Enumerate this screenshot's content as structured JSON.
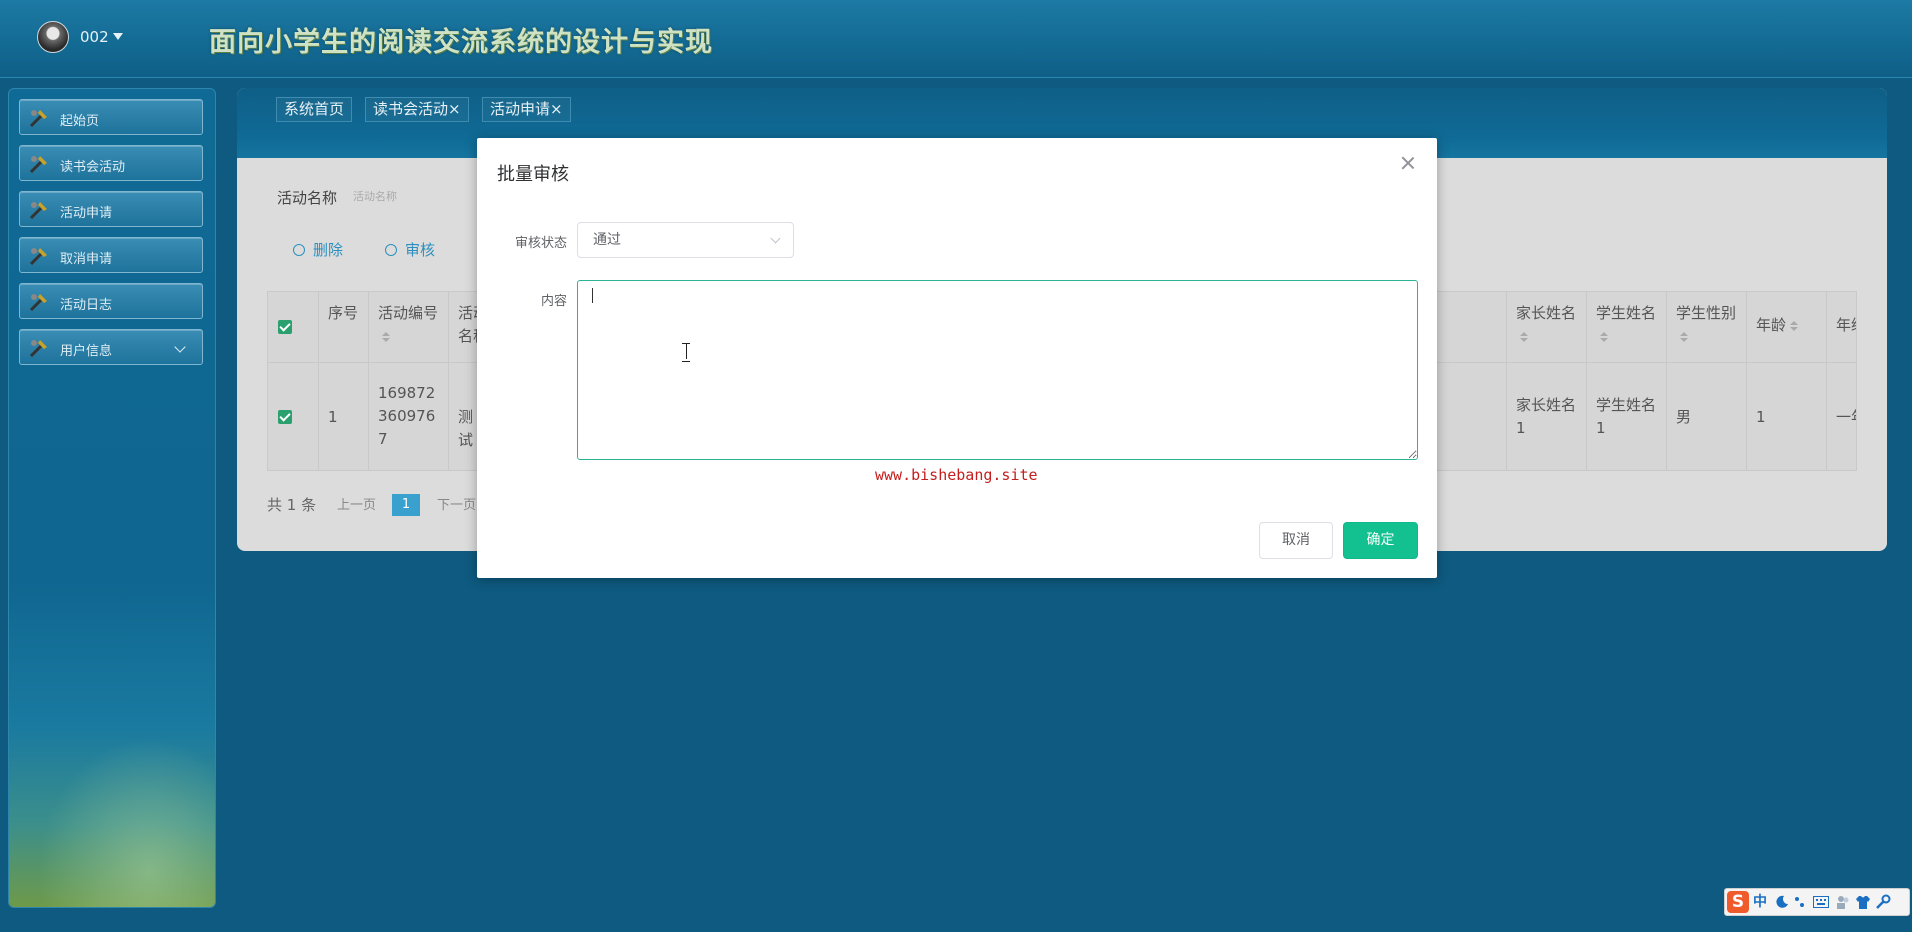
{
  "header": {
    "user_name": "002",
    "title": "面向小学生的阅读交流系统的设计与实现"
  },
  "sidebar": {
    "items": [
      {
        "label": "起始页"
      },
      {
        "label": "读书会活动"
      },
      {
        "label": "活动申请"
      },
      {
        "label": "取消申请"
      },
      {
        "label": "活动日志"
      },
      {
        "label": "用户信息"
      }
    ]
  },
  "tabs": [
    {
      "label": "系统首页"
    },
    {
      "label": "读书会活动",
      "close": "×"
    },
    {
      "label": "活动申请",
      "close": "×"
    }
  ],
  "filter": {
    "label": "活动名称",
    "placeholder": "活动名称"
  },
  "toolbar": {
    "delete_label": "删除",
    "audit_label": "审核"
  },
  "table": {
    "headers": {
      "index": "序号",
      "activity_no": "活动编号",
      "activity_name": "活动名称",
      "parent_name": "家长姓名",
      "student_name": "学生姓名",
      "student_gender": "学生性别",
      "age": "年龄",
      "grade": "年级"
    },
    "rows": [
      {
        "index": "1",
        "activity_no": "1698723609767",
        "activity_name": "测试",
        "parent_name": "家长姓名1",
        "student_name": "学生姓名1",
        "student_gender": "男",
        "age": "1",
        "grade": "一年级"
      }
    ]
  },
  "pager": {
    "total": "共 1 条",
    "prev": "上一页",
    "current": "1",
    "next": "下一页"
  },
  "dialog": {
    "title": "批量审核",
    "status_label": "审核状态",
    "status_value": "通过",
    "content_label": "内容",
    "content_value": "",
    "watermark": "www.bishebang.site",
    "cancel_label": "取消",
    "ok_label": "确定"
  },
  "ime": {
    "logo": "S",
    "mode": "中"
  },
  "colors": {
    "accent": "#13c08f",
    "link": "#2d8fbf",
    "watermark": "#c41e1e"
  }
}
